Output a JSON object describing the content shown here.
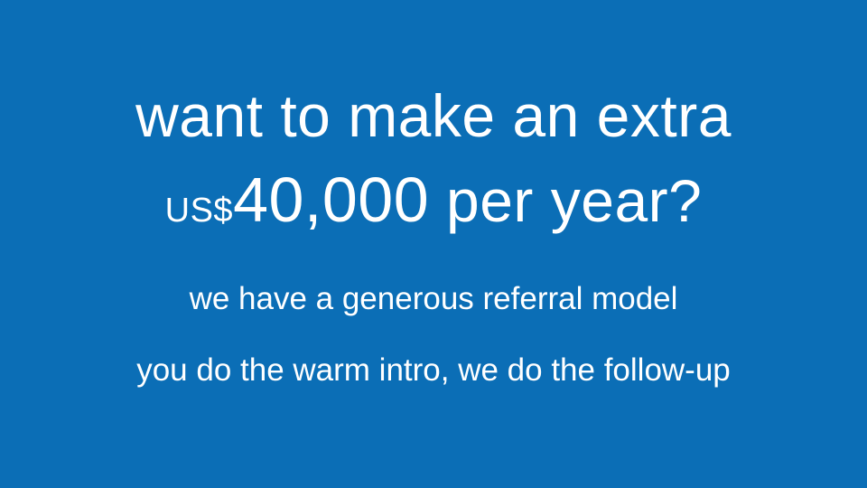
{
  "slide": {
    "headline_line1": "want to make an extra",
    "currency_prefix": "US$",
    "amount": "40,000",
    "headline_line2_suffix": " per year?",
    "subline1": "we have a generous referral model",
    "subline2": "you do the warm intro, we do the follow-up"
  },
  "colors": {
    "background": "#0b6eb6",
    "text": "#ffffff"
  }
}
